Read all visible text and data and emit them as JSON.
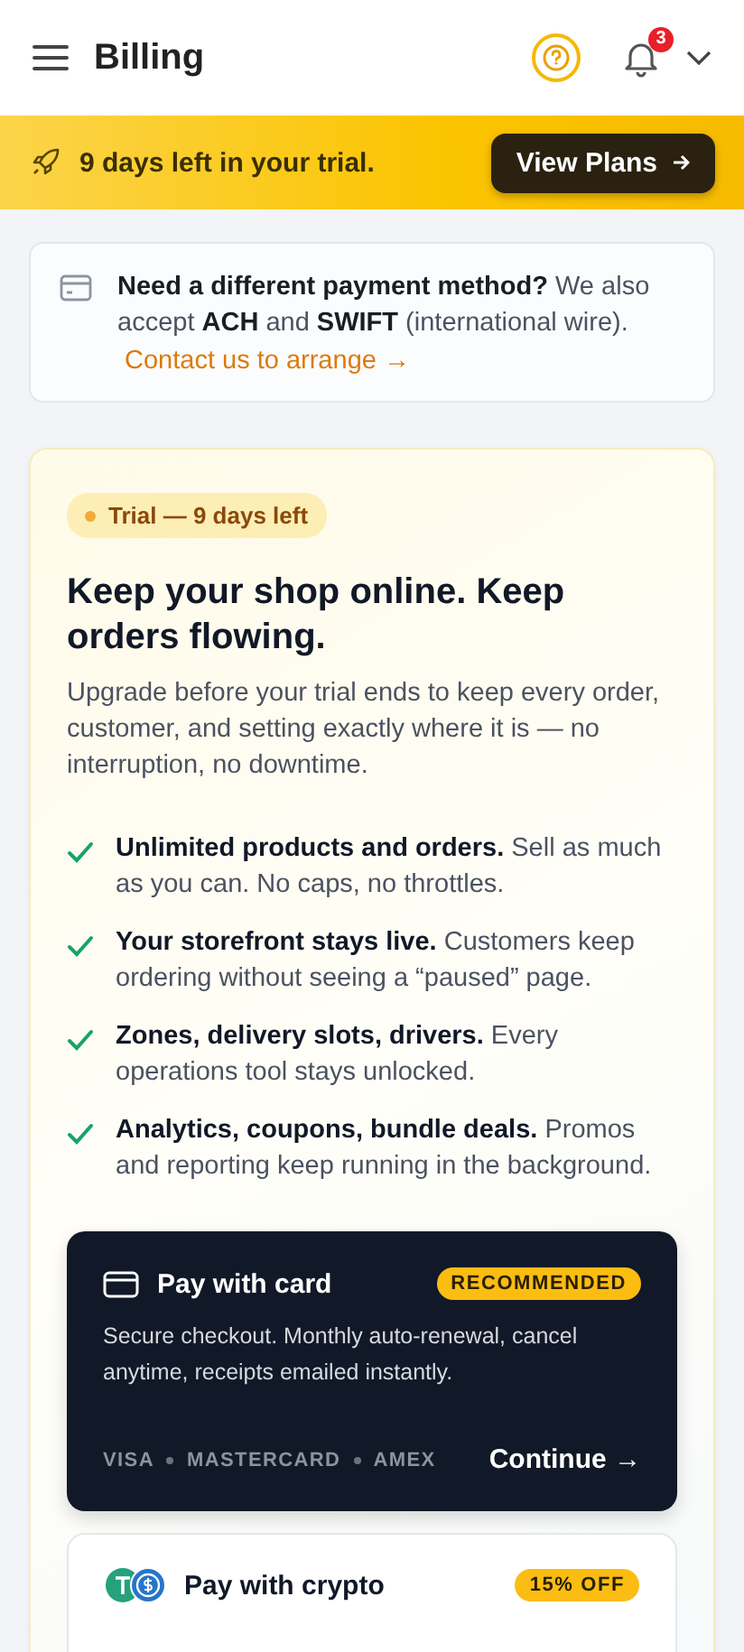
{
  "header": {
    "title": "Billing",
    "notification_count": "3"
  },
  "trial_banner": {
    "text": "9 days left in your trial.",
    "button": "View Plans"
  },
  "payment_note": {
    "text": "**Need a different payment method?** We also accept **ACH** and **SWIFT** (international wire).",
    "link": "Contact us to arrange →"
  },
  "trial_card": {
    "badge": "Trial — 9 days left",
    "heading": "Keep your shop online. Keep orders flowing.",
    "subtitle": "Upgrade before your trial ends to keep every order, customer, and setting exactly where it is — no interruption, no downtime.",
    "features": [
      {
        "text": "**Unlimited products and orders.** Sell as much as you can. No caps, no throttles."
      },
      {
        "text": "**Your storefront stays live.** Customers keep ordering without seeing a “paused” page."
      },
      {
        "text": "**Zones, delivery slots, drivers.** Every operations tool stays unlocked."
      },
      {
        "text": "**Analytics, coupons, bundle deals.** Promos and reporting keep running in the background."
      }
    ]
  },
  "payment_options": [
    {
      "kind": "card",
      "title": "Pay with card",
      "badge": "RECOMMENDED",
      "description": "Secure checkout. Monthly auto-renewal, cancel anytime, receipts emailed instantly.",
      "networks": [
        "VISA",
        "MASTERCARD",
        "AMEX"
      ],
      "action": "Continue →"
    },
    {
      "kind": "crypto",
      "title": "Pay with crypto",
      "badge": "15% OFF"
    }
  ]
}
